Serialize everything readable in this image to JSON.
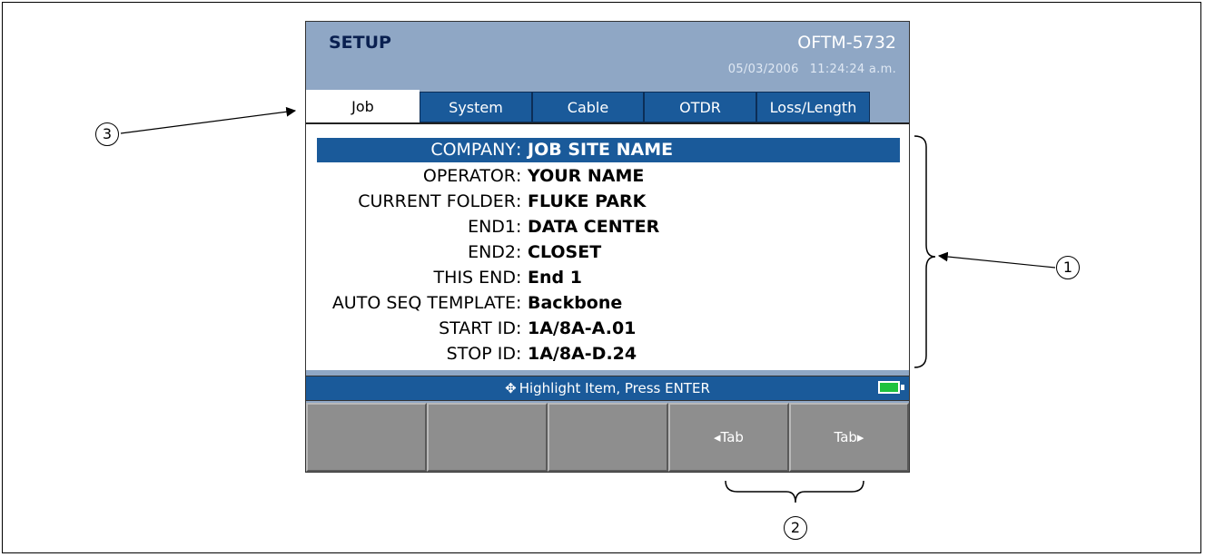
{
  "header": {
    "title": "SETUP",
    "model": "OFTM-5732",
    "date": "05/03/2006",
    "time": "11:24:24 a.m."
  },
  "tabs": [
    {
      "label": "Job",
      "active": true
    },
    {
      "label": "System",
      "active": false
    },
    {
      "label": "Cable",
      "active": false
    },
    {
      "label": "OTDR",
      "active": false
    },
    {
      "label": "Loss/Length",
      "active": false
    }
  ],
  "fields": [
    {
      "label": "COMPANY",
      "sep": ":",
      "value": "JOB SITE NAME",
      "selected": true
    },
    {
      "label": "OPERATOR",
      "sep": ":",
      "value": "YOUR NAME"
    },
    {
      "label": "CURRENT FOLDER",
      "sep": ":",
      "value": "FLUKE PARK"
    },
    {
      "label": "END1",
      "sep": ":",
      "value": "DATA CENTER"
    },
    {
      "label": "END2",
      "sep": ":",
      "value": "CLOSET"
    },
    {
      "label": "THIS END",
      "sep": ":",
      "value": "End 1"
    },
    {
      "label": "AUTO SEQ TEMPLATE",
      "sep": ":",
      "value": "Backbone"
    },
    {
      "label": "START ID",
      "sep": ":",
      "value": "1A/8A-A.01"
    },
    {
      "label": "STOP ID",
      "sep": ":",
      "value": "1A/8A-D.24"
    }
  ],
  "status": {
    "arrows_glyph": "✥",
    "text": "Highlight Item, Press ENTER",
    "battery_icon": "battery-full-icon",
    "battery_color": "#1ec23e"
  },
  "softkeys": [
    {
      "label": ""
    },
    {
      "label": ""
    },
    {
      "label": ""
    },
    {
      "label": "◂Tab"
    },
    {
      "label": "Tab▸"
    }
  ],
  "callouts": {
    "one": "1",
    "two": "2",
    "three": "3"
  },
  "colors": {
    "header_bg": "#8fa7c5",
    "tab_blue": "#1a5a9a",
    "selection": "#1a5a9a",
    "softkey_gray": "#8e8e8e"
  }
}
